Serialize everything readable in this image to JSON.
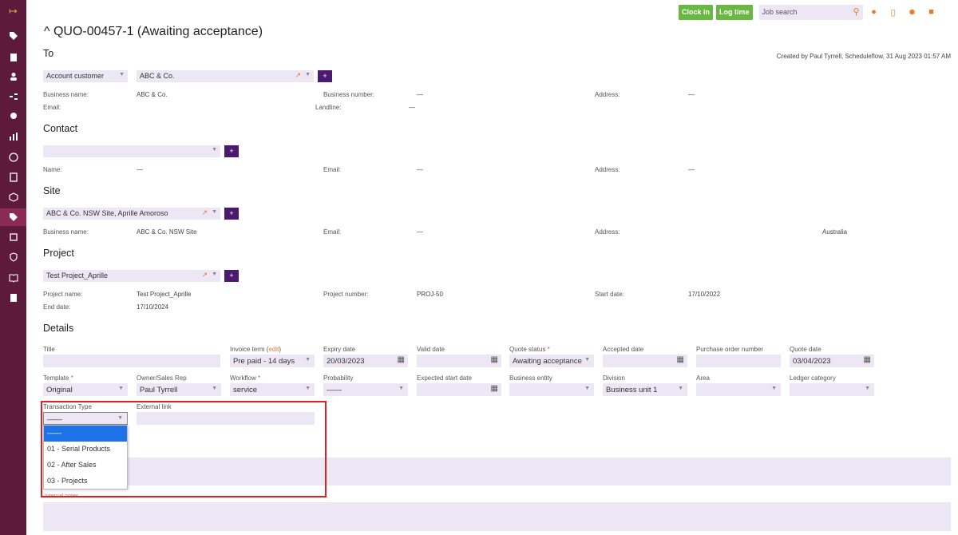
{
  "topbar": {
    "clock_in": "Clock in",
    "log_time": "Log time",
    "search_placeholder": "Job search"
  },
  "header": {
    "title": "QUO-00457-1 (Awaiting acceptance)",
    "created": "Created by Paul Tyrrell, Scheduleflow, 31 Aug 2023 01:57 AM"
  },
  "to": {
    "heading": "To",
    "customer_type": "Account customer",
    "customer": "ABC & Co.",
    "business_name_label": "Business name:",
    "business_name": "ABC & Co.",
    "business_number_label": "Business number:",
    "business_number": "—",
    "address_label": "Address:",
    "address": "—",
    "email_label": "Email:",
    "landline_label": "Landline:",
    "landline": "—"
  },
  "contact": {
    "heading": "Contact",
    "name_label": "Name:",
    "name": "—",
    "email_label": "Email:",
    "email": "—",
    "address_label": "Address:",
    "address": "—"
  },
  "site": {
    "heading": "Site",
    "selected": "ABC & Co. NSW Site, Aprille Amoroso",
    "business_name_label": "Business name:",
    "business_name": "ABC & Co. NSW Site",
    "email_label": "Email:",
    "email": "—",
    "address_label": "Address:",
    "address": "Australia"
  },
  "project": {
    "heading": "Project",
    "selected": "Test Project_Aprille",
    "name_label": "Project name:",
    "name": "Test Project_Aprille",
    "number_label": "Project number:",
    "number": "PROJ-50",
    "start_label": "Start date:",
    "start": "17/10/2022",
    "end_label": "End date:",
    "end": "17/10/2024"
  },
  "details": {
    "heading": "Details",
    "title_label": "Title",
    "invoice_term_label": "Invoice term (",
    "invoice_term_edit": "edit",
    "invoice_term_close": ")",
    "invoice_term": "Pre paid - 14 days",
    "expiry_label": "Expiry date",
    "expiry": "20/03/2023",
    "valid_label": "Valid date",
    "quote_status_label": "Quote status",
    "quote_status": "Awaiting acceptance",
    "accepted_label": "Accepted date",
    "po_label": "Purchase order number",
    "quote_date_label": "Quote date",
    "quote_date": "03/04/2023",
    "template_label": "Template",
    "template": "Original",
    "owner_label": "Owner/Sales Rep",
    "owner": "Paul Tyrrell",
    "workflow_label": "Workflow",
    "workflow": "service",
    "probability_label": "Probability",
    "probability": "——",
    "expected_start_label": "Expected start date",
    "business_entity_label": "Business entity",
    "division_label": "Division",
    "division": "Business unit 1",
    "area_label": "Area",
    "ledger_label": "Ledger category",
    "transaction_type_label": "Transaction Type",
    "transaction_type": "——",
    "external_link_label": "External link",
    "required_mark": "*"
  },
  "transaction_dropdown": {
    "options": [
      "——",
      "01 - Serial Products",
      "02 - After Sales",
      "03 - Projects"
    ]
  },
  "notes": {
    "internal_notes_label": "Internal notes"
  },
  "colors": {
    "sidebar": "#5e1a3a",
    "accent": "#e37b2b",
    "field_bg": "#ede6f5",
    "plus_button": "#4b1a6e",
    "green_button": "#6ab744",
    "highlight": "#e02020"
  }
}
